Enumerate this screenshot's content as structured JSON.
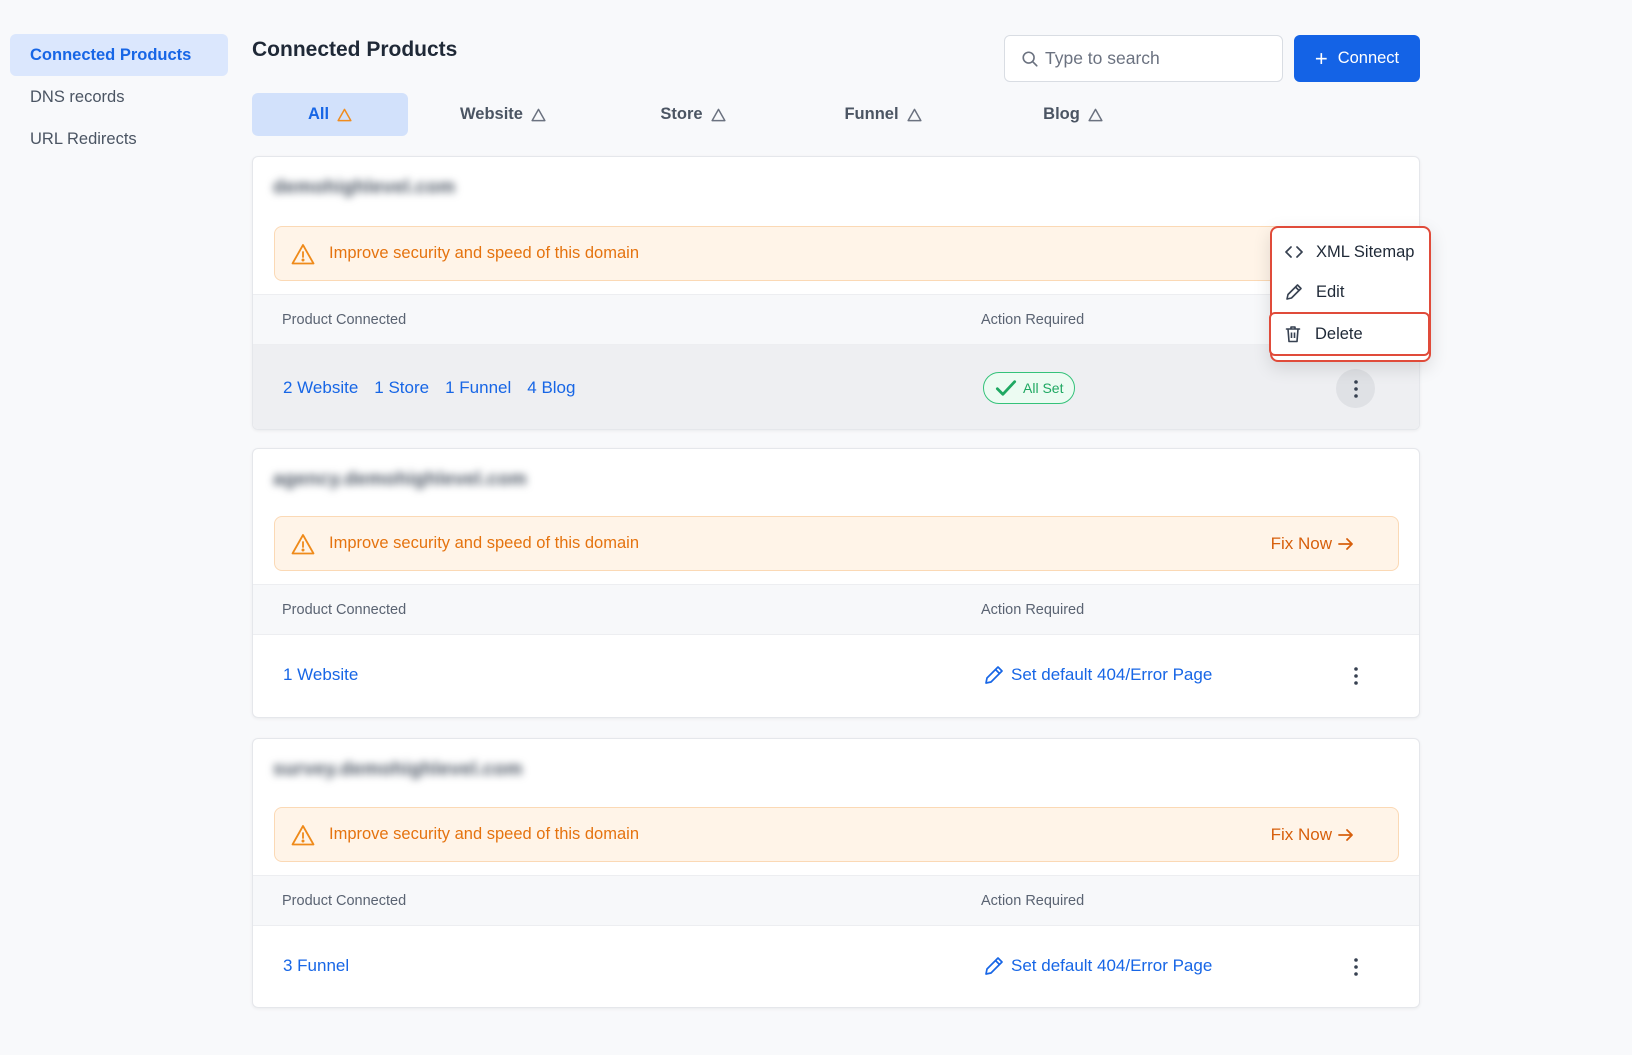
{
  "sidebar": {
    "items": [
      {
        "label": "Connected Products",
        "active": true
      },
      {
        "label": "DNS records",
        "active": false
      },
      {
        "label": "URL Redirects",
        "active": false
      }
    ]
  },
  "header": {
    "title": "Connected Products",
    "search_placeholder": "Type to search",
    "connect_label": "Connect"
  },
  "tabs": [
    {
      "label": "All",
      "active": true
    },
    {
      "label": "Website",
      "active": false
    },
    {
      "label": "Store",
      "active": false
    },
    {
      "label": "Funnel",
      "active": false
    },
    {
      "label": "Blog",
      "active": false
    }
  ],
  "table_headers": {
    "product": "Product Connected",
    "action": "Action Required"
  },
  "banner_text": "Improve security and speed of this domain",
  "fix_now_label": "Fix Now",
  "domains": [
    {
      "name": "demohighlevel.com",
      "products": [
        "2 Website",
        "1 Store",
        "1 Funnel",
        "4 Blog"
      ],
      "status": "All Set"
    },
    {
      "name": "agency.demohighlevel.com",
      "products": [
        "1 Website"
      ],
      "action": "Set default 404/Error Page"
    },
    {
      "name": "survey.demohighlevel.com",
      "products": [
        "3 Funnel"
      ],
      "action": "Set default 404/Error Page"
    }
  ],
  "menu": {
    "items": [
      {
        "label": "XML Sitemap",
        "icon": "code-icon"
      },
      {
        "label": "Edit",
        "icon": "pencil-icon"
      },
      {
        "label": "Delete",
        "icon": "trash-icon"
      }
    ]
  },
  "colors": {
    "primary": "#1463e6",
    "warning": "#e5730f",
    "success": "#1fa862",
    "highlight": "#e04b3a"
  }
}
